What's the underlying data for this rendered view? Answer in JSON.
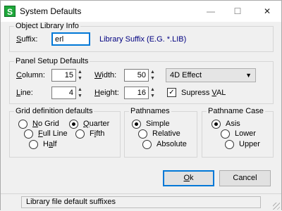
{
  "window": {
    "title": "System Defaults",
    "icon_glyph": "S",
    "minimize_glyph": "—",
    "maximize_glyph": "☐",
    "close_glyph": "✕"
  },
  "object_library": {
    "legend": "Object Library Info",
    "suffix_label": "Suffix:",
    "suffix_value": "erl",
    "hint": "Library Suffix (E.G. *.LIB)"
  },
  "panel_setup": {
    "legend": "Panel Setup Defaults",
    "column_label": "Column:",
    "column_value": "15",
    "line_label": "Line:",
    "line_value": "4",
    "width_label": "Width:",
    "width_value": "50",
    "height_label": "Height:",
    "height_value": "16",
    "effect_selected": "4D Effect",
    "supress_label": "Supress VAL",
    "supress_checked": true
  },
  "grid_definition": {
    "legend": "Grid definition defaults",
    "options": [
      "No Grid",
      "Quarter",
      "Full Line",
      "Fifth",
      "Half"
    ],
    "selected": "Quarter"
  },
  "pathnames": {
    "legend": "Pathnames",
    "options": [
      "Simple",
      "Relative",
      "Absolute"
    ],
    "selected": "Simple"
  },
  "pathname_case": {
    "legend": "Pathname Case",
    "options": [
      "Asis",
      "Lower",
      "Upper"
    ],
    "selected": "Asis"
  },
  "buttons": {
    "ok": "Ok",
    "cancel": "Cancel"
  },
  "status": {
    "text": "Library file default suffixes"
  },
  "colors": {
    "accent": "#0078d7",
    "hint_text": "#000080",
    "app_icon": "#1ea83a"
  }
}
